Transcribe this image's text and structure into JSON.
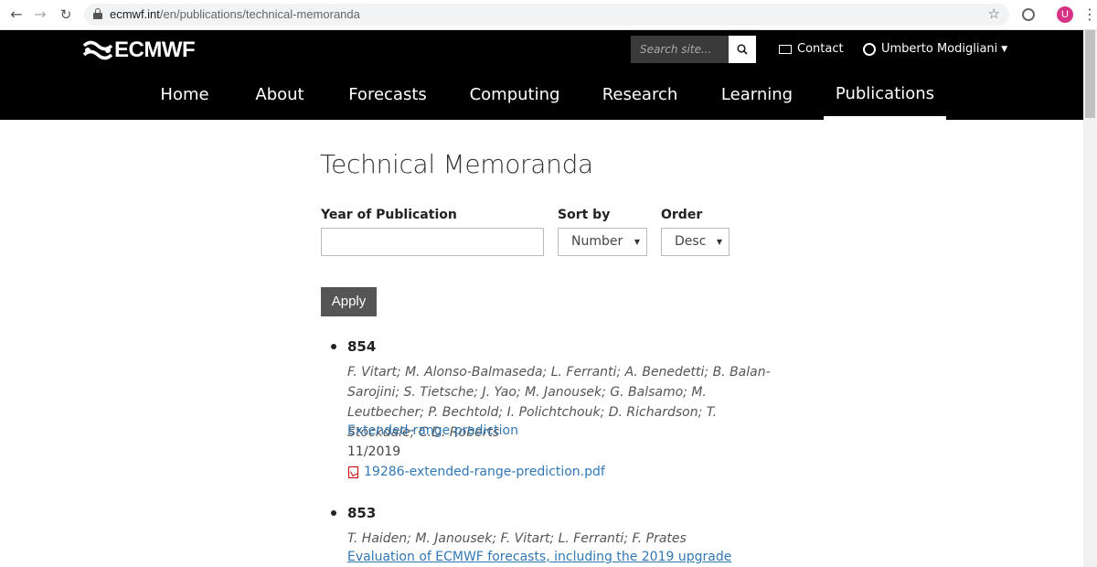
{
  "browser": {
    "url_host": "ecmwf.int",
    "url_path": "/en/publications/technical-memoranda",
    "avatar_letter": "U"
  },
  "header": {
    "logo_text": "ECMWF",
    "search_placeholder": "Search site...",
    "contact_label": "Contact",
    "user_name": "Umberto Modigliani"
  },
  "nav": {
    "items": [
      "Home",
      "About",
      "Forecasts",
      "Computing",
      "Research",
      "Learning",
      "Publications"
    ],
    "active": "Publications"
  },
  "page": {
    "title": "Technical Memoranda",
    "filters": {
      "year_label": "Year of Publication",
      "year_value": "",
      "sort_label": "Sort by",
      "sort_value": "Number",
      "order_label": "Order",
      "order_value": "Desc",
      "apply_label": "Apply"
    },
    "publications": [
      {
        "number": "854",
        "authors": "F. Vitart; M. Alonso-Balmaseda; L. Ferranti; A. Benedetti; B. Balan-Sarojini; S. Tietsche; J. Yao; M. Janousek; G. Balsamo; M. Leutbecher; P. Bechtold; I. Polichtchouk; D. Richardson; T. Stockdale; C.D. Roberts",
        "title": "Extended-range prediction",
        "date": "11/2019",
        "pdf": "19286-extended-range-prediction.pdf"
      },
      {
        "number": "853",
        "authors": "T. Haiden; M. Janousek; F. Vitart; L. Ferranti; F. Prates",
        "title": "Evaluation of ECMWF forecasts, including the 2019 upgrade"
      }
    ]
  },
  "colors": {
    "link": "#3178b5",
    "header_bg": "#000000",
    "button_bg": "#555555"
  }
}
